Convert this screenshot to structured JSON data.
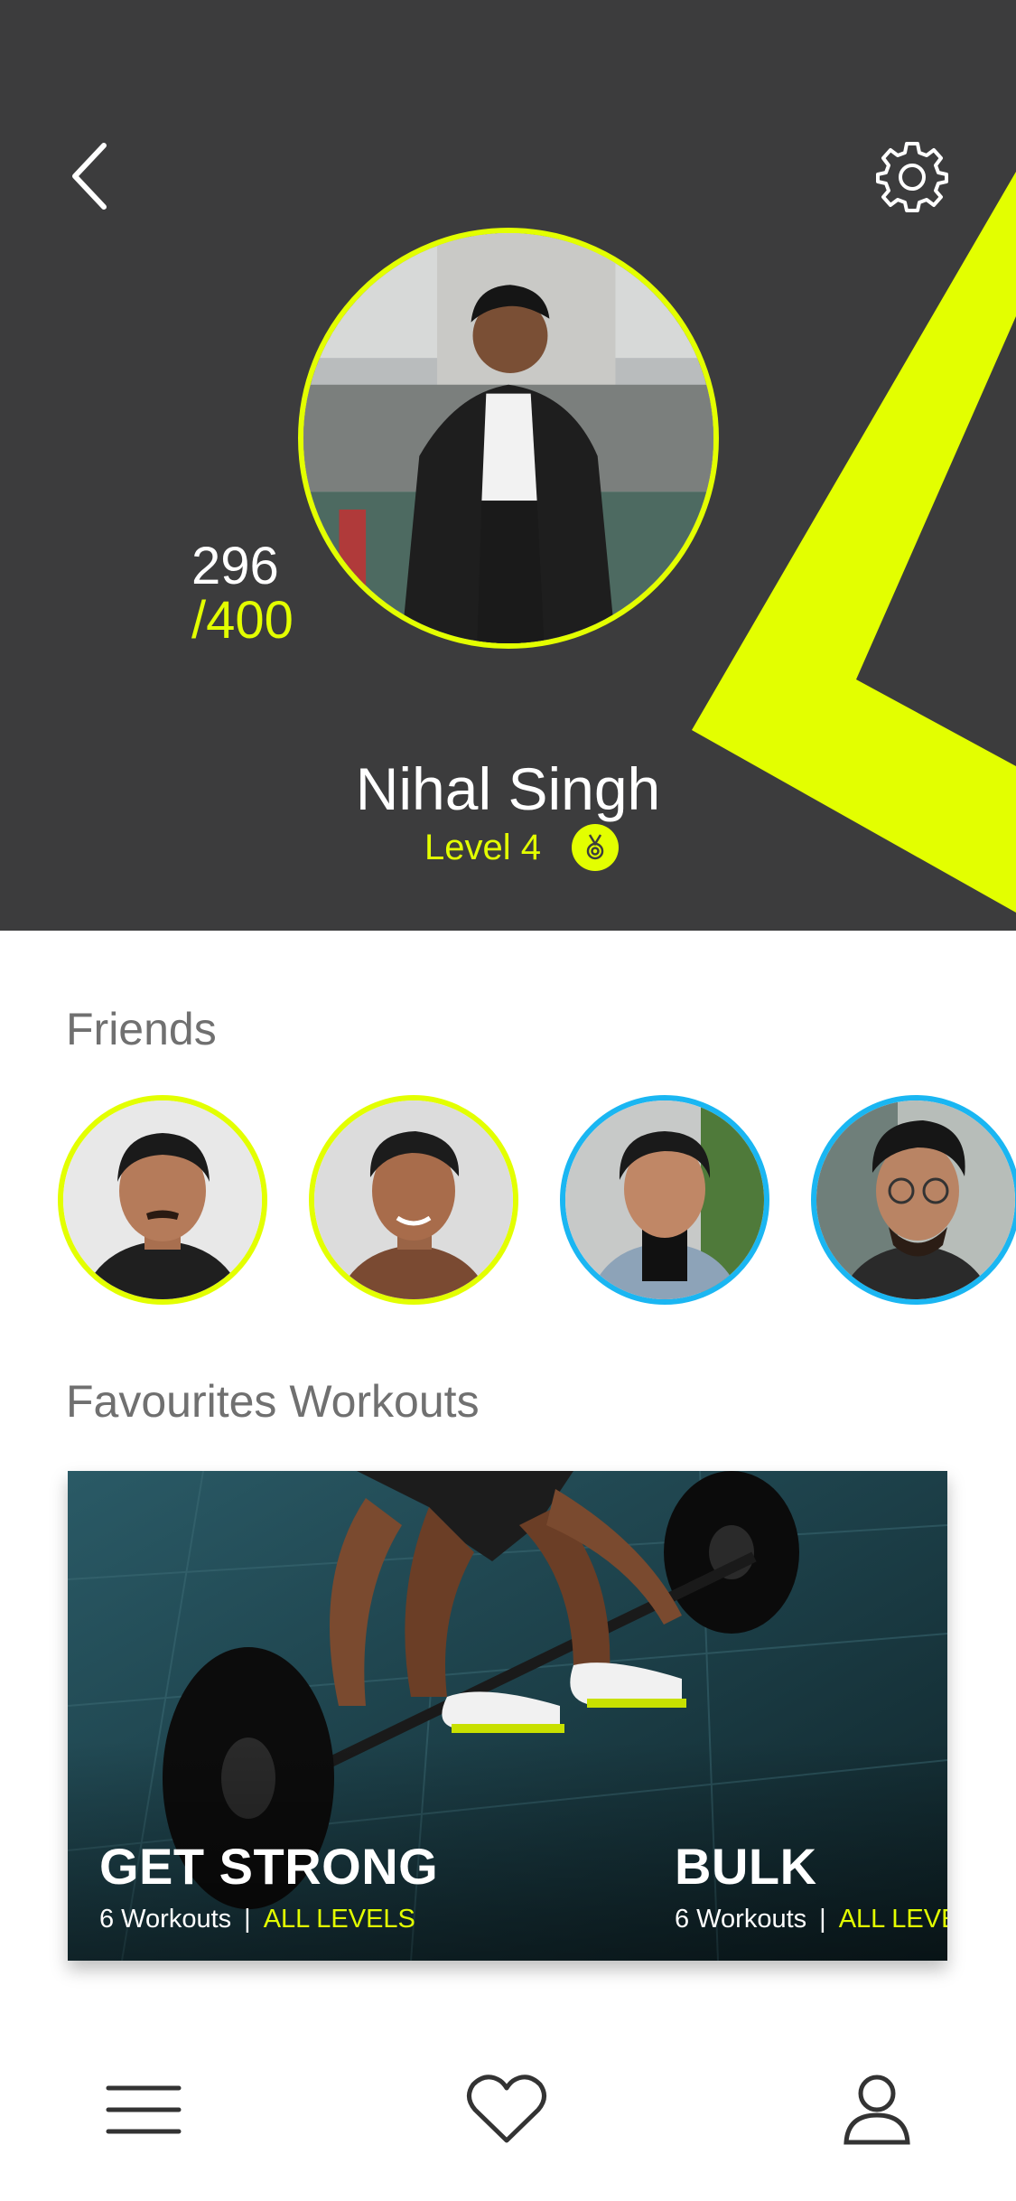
{
  "profile": {
    "name": "Nihal Singh",
    "level": "Level 4",
    "points_current": "296",
    "points_total": "/400"
  },
  "friends": {
    "title": "Friends",
    "items": [
      {
        "ring": "#e3ff00"
      },
      {
        "ring": "#e3ff00"
      },
      {
        "ring": "#1ab6f2"
      },
      {
        "ring": "#1ab6f2"
      }
    ]
  },
  "workouts": {
    "title": "Favourites Workouts",
    "cards": [
      {
        "title": "GET STRONG",
        "count": "6 Workouts",
        "separator": "|",
        "level": "ALL LEVELS"
      },
      {
        "title": "BULK",
        "count": "6 Workouts",
        "separator": "|",
        "level": "ALL LEVELS"
      }
    ]
  },
  "icons": {
    "back": "chevron-left-icon",
    "settings": "gear-icon",
    "badge": "medal-icon",
    "menu": "menu-icon",
    "favourites": "heart-icon",
    "profile": "user-icon"
  },
  "colors": {
    "header_bg": "#3c3c3d",
    "accent": "#e3ff00",
    "secondary_ring": "#1ab6f2",
    "section_text": "#707070"
  }
}
